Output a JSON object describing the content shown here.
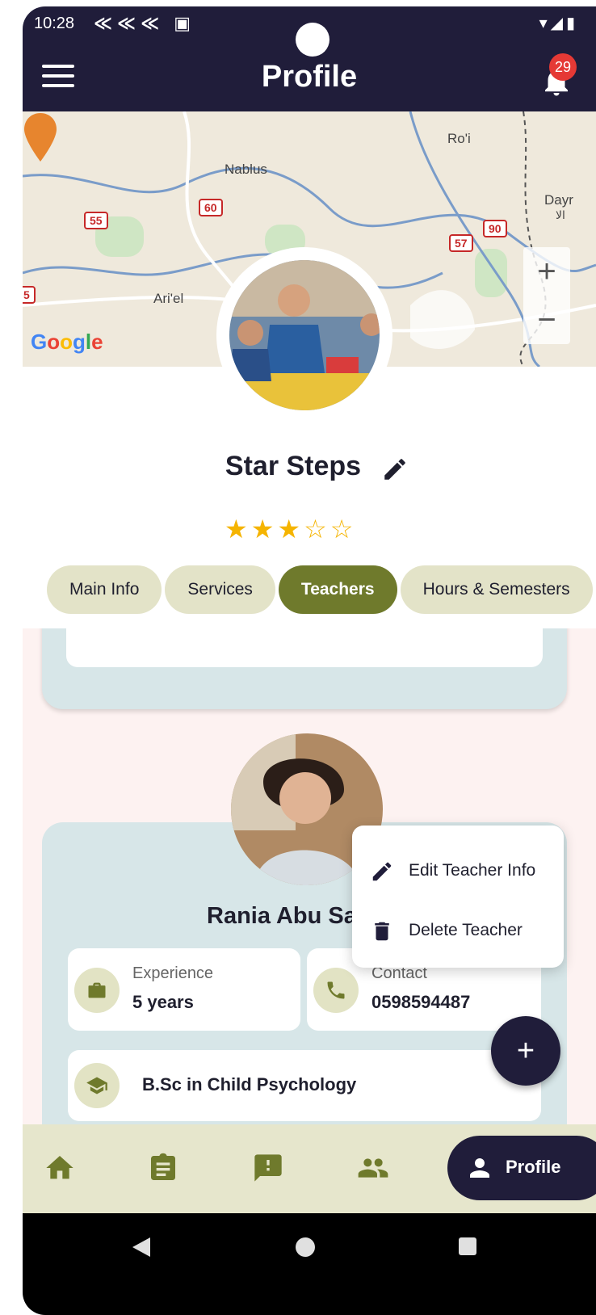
{
  "status_bar": {
    "time": "10:28",
    "notification_icons": "≪≪≪ ▣",
    "system_icons": "▾◢▮"
  },
  "app_bar": {
    "title": "Profile",
    "notification_count": "29"
  },
  "map": {
    "labels": {
      "nablus": "Nablus",
      "roi": "Ro'i",
      "ariel": "Ari'el",
      "dayr": "Dayr",
      "dayr_ar": "ﺍﻟﺎ"
    },
    "routes": {
      "r55": "55",
      "r60": "60",
      "r90": "90",
      "r57": "57",
      "r5": "5"
    },
    "google": "Google",
    "zoom_in": "+",
    "zoom_out": "−"
  },
  "school": {
    "name": "Star Steps",
    "rating": 3,
    "rating_text": "★★★☆☆"
  },
  "tabs": [
    "Main Info",
    "Services",
    "Teachers",
    "Hours & Semesters"
  ],
  "active_tab": "Teachers",
  "teacher": {
    "name": "Rania Abu Saleh",
    "experience_label": "Experience",
    "experience_value": "5 years",
    "contact_label": "Contact",
    "contact_value": "0598594487",
    "degree": "B.Sc in Child Psychology"
  },
  "popup_menu": {
    "edit": "Edit Teacher Info",
    "delete": "Delete Teacher"
  },
  "fab_label": "+",
  "bottom_nav": {
    "profile_label": "Profile"
  },
  "colors": {
    "navy": "#201d3a",
    "olive": "#6f7a2c",
    "light_olive": "#e3e3c8",
    "card_blue": "#d7e6e8",
    "star": "#f5b400"
  }
}
